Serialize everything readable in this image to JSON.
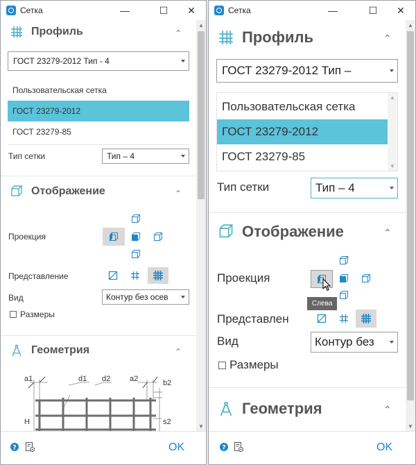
{
  "window": {
    "title": "Сетка"
  },
  "controls": {
    "minimize": "—",
    "maximize": "☐",
    "close": "✕"
  },
  "profile": {
    "title": "Профиль",
    "icon": "grid-icon",
    "standard_value": "ГОСТ 23279-2012 Тип - 4",
    "standard_value_truncated": "ГОСТ 23279-2012 Тип –",
    "list": [
      "Пользовательская сетка",
      "ГОСТ 23279-2012",
      "ГОСТ 23279-85"
    ],
    "selected_index": 1,
    "grid_type_label": "Тип сетки",
    "grid_type_value": "Тип – 4"
  },
  "display": {
    "title": "Отображение",
    "icon": "cube-icon",
    "projection_label": "Проекция",
    "representation_label": "Представление",
    "representation_label_truncated": "Представлен",
    "view_label": "Вид",
    "view_value": "Контур без осевых",
    "view_value_left": "Контур без осев",
    "view_value_right": "Контур без",
    "dimensions_label": "Размеры"
  },
  "geometry": {
    "title": "Геометрия",
    "icon": "compass-icon",
    "labels": {
      "a1": "a1",
      "d1": "d1",
      "d2": "d2",
      "a2": "a2",
      "b2": "b2",
      "H": "H",
      "s2": "s2"
    }
  },
  "footer": {
    "ok": "OK"
  },
  "tooltip": {
    "text": "Слева"
  },
  "colors": {
    "accent": "#1e88c9",
    "selected": "#5bc3da",
    "heading_icon": "#4fb4c8"
  }
}
